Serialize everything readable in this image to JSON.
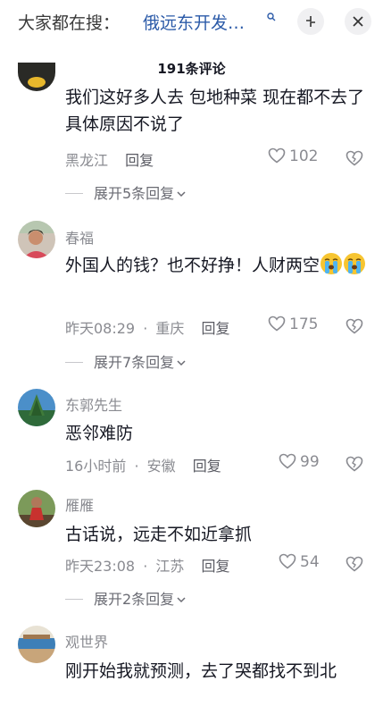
{
  "header": {
    "search_prefix": "大家都在搜：",
    "search_query": "俄远东开发…",
    "comment_count_label": "191条评论"
  },
  "comments": [
    {
      "text": "我们这好多人去 包地种菜 现在都不去了 具体原因不说了",
      "location": "黑龙江",
      "reply_label": "回复",
      "likes": "102",
      "expand_label": "展开5条回复"
    },
    {
      "username": "春福",
      "text": "外国人的钱？也不好挣！人财两空",
      "time": "昨天08:29",
      "separator": "·",
      "location": "重庆",
      "reply_label": "回复",
      "likes": "175",
      "expand_label": "展开7条回复"
    },
    {
      "username": "东郭先生",
      "text": "恶邻难防",
      "time": "16小时前",
      "separator": "·",
      "location": "安徽",
      "reply_label": "回复",
      "likes": "99"
    },
    {
      "username": "雁雁",
      "text": "古话说，远走不如近拿抓",
      "time": "昨天23:08",
      "separator": "·",
      "location": "江苏",
      "reply_label": "回复",
      "likes": "54",
      "expand_label": "展开2条回复"
    },
    {
      "username": "观世界",
      "text": "刚开始我就预测，去了哭都找不到北"
    }
  ],
  "icons": {
    "search": "search-icon",
    "collapse": "collapse-icon",
    "close": "close-icon",
    "like": "heart-icon",
    "dislike": "broken-heart-icon",
    "expand": "chevron-down-icon",
    "crying_emoji": "crying-face-icon"
  }
}
